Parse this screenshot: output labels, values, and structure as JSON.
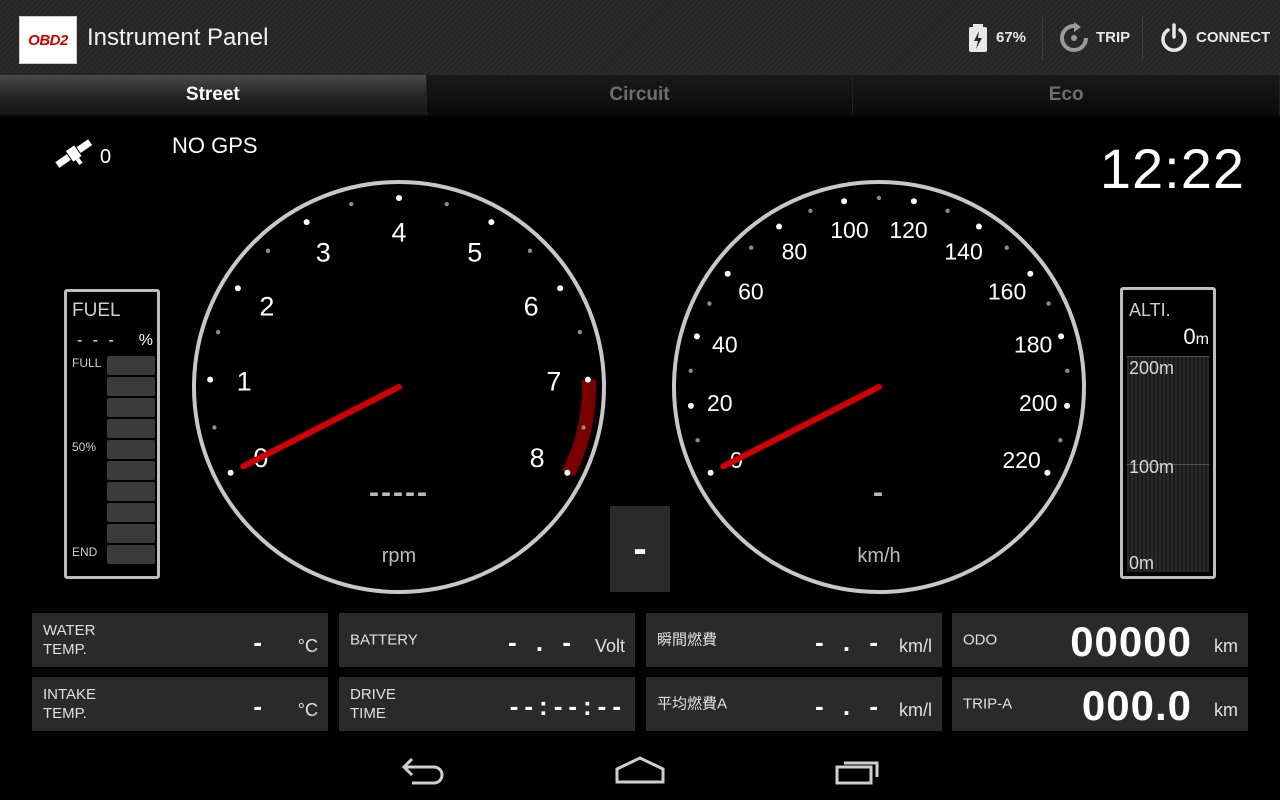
{
  "app": {
    "logo_text": "OBD2",
    "title": "Instrument Panel"
  },
  "actions": {
    "battery": "67%",
    "trip": "TRIP",
    "connect": "CONNECT"
  },
  "tabs": [
    "Street",
    "Circuit",
    "Eco"
  ],
  "status": {
    "satellites": "0",
    "gps": "NO GPS",
    "clock": "12:22"
  },
  "fuel": {
    "title": "FUEL",
    "value": "- - -",
    "unit": "%",
    "full": "FULL",
    "half": "50%",
    "end": "END",
    "bar_count": 10
  },
  "tachometer": {
    "labels": [
      "0",
      "1",
      "2",
      "3",
      "4",
      "5",
      "6",
      "7",
      "8"
    ],
    "readout": "-----",
    "unit": "rpm",
    "needle_value": 0
  },
  "speedometer": {
    "labels": [
      "0",
      "20",
      "40",
      "60",
      "80",
      "100",
      "120",
      "140",
      "160",
      "180",
      "200",
      "220"
    ],
    "readout": "-",
    "unit": "km/h",
    "needle_value": 0
  },
  "gear": {
    "value": "-"
  },
  "altitude": {
    "title": "ALTI.",
    "value": "0",
    "unit": "m",
    "scale": [
      "200m",
      "100m",
      "0m"
    ]
  },
  "panels": {
    "water_temp": {
      "label": "WATER\nTEMP.",
      "value": "-",
      "unit": "°C"
    },
    "battery": {
      "label": "BATTERY",
      "value": "- . -",
      "unit": "Volt"
    },
    "instant_fuel": {
      "label": "瞬間燃費",
      "value": "- . -",
      "unit": "km/l"
    },
    "odo": {
      "label": "ODO",
      "value": "00000",
      "unit": "km"
    },
    "intake_temp": {
      "label": "INTAKE\nTEMP.",
      "value": "-",
      "unit": "°C"
    },
    "drive_time": {
      "label": "DRIVE\nTIME",
      "value": "--:--:--",
      "unit": ""
    },
    "avg_fuel": {
      "label": "平均燃費A",
      "value": "- . -",
      "unit": "km/l"
    },
    "trip_a": {
      "label": "TRIP-A",
      "value": "000.0",
      "unit": "km"
    }
  },
  "colors": {
    "needle": "#d40000",
    "redzone": "#7a0000",
    "ring": "#c8c8c8"
  },
  "nav": {
    "back": "back-icon",
    "home": "home-icon",
    "recent": "recent-apps-icon"
  }
}
